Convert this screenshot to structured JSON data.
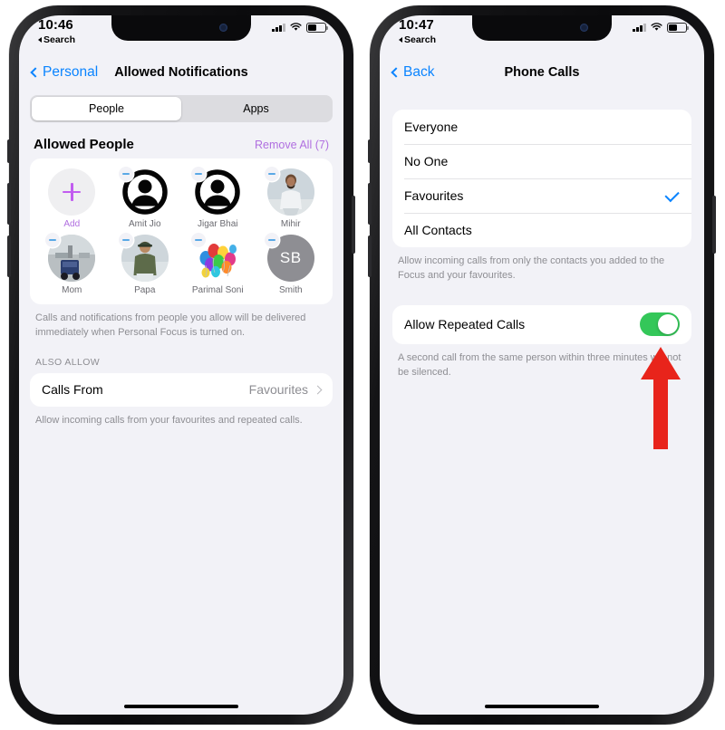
{
  "colors": {
    "accent_blue": "#0a84ff",
    "purple": "#b06fe0",
    "green_toggle": "#34c759",
    "background": "#f2f2f7",
    "card": "#ffffff",
    "secondary_text": "#8e8e93",
    "annotation_red": "#e8241b"
  },
  "phones": [
    {
      "status_bar": {
        "time": "10:46",
        "back_app": "Search",
        "signal_icon": "cellular-signal-icon",
        "wifi_icon": "wifi-icon",
        "battery_icon": "battery-icon"
      },
      "nav": {
        "back_label": "Personal",
        "back_icon": "chevron-left-icon",
        "title": "Allowed Notifications"
      },
      "segmented": {
        "options": [
          "People",
          "Apps"
        ],
        "selected": "People"
      },
      "section": {
        "title": "Allowed People",
        "action_label": "Remove All (7)"
      },
      "people": [
        {
          "name": "Add",
          "type": "add",
          "badge": false,
          "avatar_icon": "plus-icon"
        },
        {
          "name": "Amit Jio",
          "type": "silhouette",
          "badge": true,
          "avatar_icon": "person-silhouette-icon"
        },
        {
          "name": "Jigar Bhai",
          "type": "silhouette",
          "badge": true,
          "avatar_icon": "person-silhouette-icon"
        },
        {
          "name": "Mihir",
          "type": "photo-man-white-tshirt",
          "badge": true,
          "avatar_icon": "contact-photo"
        },
        {
          "name": "Mom",
          "type": "photo-beach-vehicle",
          "badge": true,
          "avatar_icon": "contact-photo"
        },
        {
          "name": "Papa",
          "type": "photo-man-cap-olive",
          "badge": true,
          "avatar_icon": "contact-photo"
        },
        {
          "name": "Parimal Soni",
          "type": "photo-balloons",
          "badge": true,
          "avatar_icon": "contact-photo"
        },
        {
          "name": "Smith",
          "type": "initials",
          "badge": true,
          "initials": "SB",
          "avatar_icon": "initials-avatar"
        }
      ],
      "footnote": "Calls and notifications from people you allow will be delivered immediately when Personal Focus is turned on.",
      "group_label": "ALSO ALLOW",
      "calls_from_row": {
        "label": "Calls From",
        "value": "Favourites",
        "chevron_icon": "chevron-right-icon"
      },
      "bottom_footnote": "Allow incoming calls from your favourites and repeated calls."
    },
    {
      "status_bar": {
        "time": "10:47",
        "back_app": "Search",
        "signal_icon": "cellular-signal-icon",
        "wifi_icon": "wifi-icon",
        "battery_icon": "battery-icon"
      },
      "nav": {
        "back_label": "Back",
        "back_icon": "chevron-left-icon",
        "title": "Phone Calls"
      },
      "options": [
        {
          "label": "Everyone",
          "selected": false
        },
        {
          "label": "No One",
          "selected": false
        },
        {
          "label": "Favourites",
          "selected": true
        },
        {
          "label": "All Contacts",
          "selected": false
        }
      ],
      "options_footnote": "Allow incoming calls from only the contacts you added to the Focus and your favourites.",
      "repeated_calls": {
        "label": "Allow Repeated Calls",
        "enabled": true,
        "toggle_icon": "toggle-switch-on"
      },
      "repeated_footnote": "A second call from the same person within three minutes will not be silenced."
    }
  ],
  "annotation": {
    "arrow_icon": "red-arrow-up-icon",
    "points_to": "Allow Repeated Calls toggle"
  }
}
